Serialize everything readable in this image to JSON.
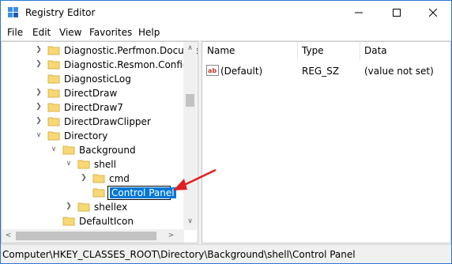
{
  "window": {
    "title": "Registry Editor",
    "accent_color": "#2b79d0"
  },
  "window_controls": {
    "minimize_icon": "minimize-icon",
    "maximize_icon": "maximize-icon",
    "close_icon": "close-icon"
  },
  "menu": [
    "File",
    "Edit",
    "View",
    "Favorites",
    "Help"
  ],
  "tree": {
    "nodes": [
      {
        "label": "Diagnostic.Perfmon.Docume",
        "expander": "collapsed"
      },
      {
        "label": "Diagnostic.Resmon.Config",
        "expander": "collapsed"
      },
      {
        "label": "DiagnosticLog",
        "expander": "none"
      },
      {
        "label": "DirectDraw",
        "expander": "collapsed"
      },
      {
        "label": "DirectDraw7",
        "expander": "collapsed"
      },
      {
        "label": "DirectDrawClipper",
        "expander": "collapsed"
      },
      {
        "label": "Directory",
        "expander": "expanded"
      },
      {
        "label": "Background",
        "expander": "expanded"
      },
      {
        "label": "shell",
        "expander": "expanded"
      },
      {
        "label": "cmd",
        "expander": "collapsed"
      },
      {
        "label": "Control Panel",
        "expander": "none",
        "editing": true
      },
      {
        "label": "shellex",
        "expander": "collapsed"
      },
      {
        "label": "DefaultIcon",
        "expander": "none"
      }
    ],
    "folder_color": "#f8d775"
  },
  "list": {
    "columns": [
      "Name",
      "Type",
      "Data"
    ],
    "rows": [
      {
        "name": "(Default)",
        "type": "REG_SZ",
        "data": "(value not set)",
        "icon": "ab-string-icon"
      }
    ]
  },
  "status": {
    "path": "Computer\\HKEY_CLASSES_ROOT\\Directory\\Background\\shell\\Control Panel"
  },
  "annotation": {
    "arrow_color": "#e02020"
  }
}
